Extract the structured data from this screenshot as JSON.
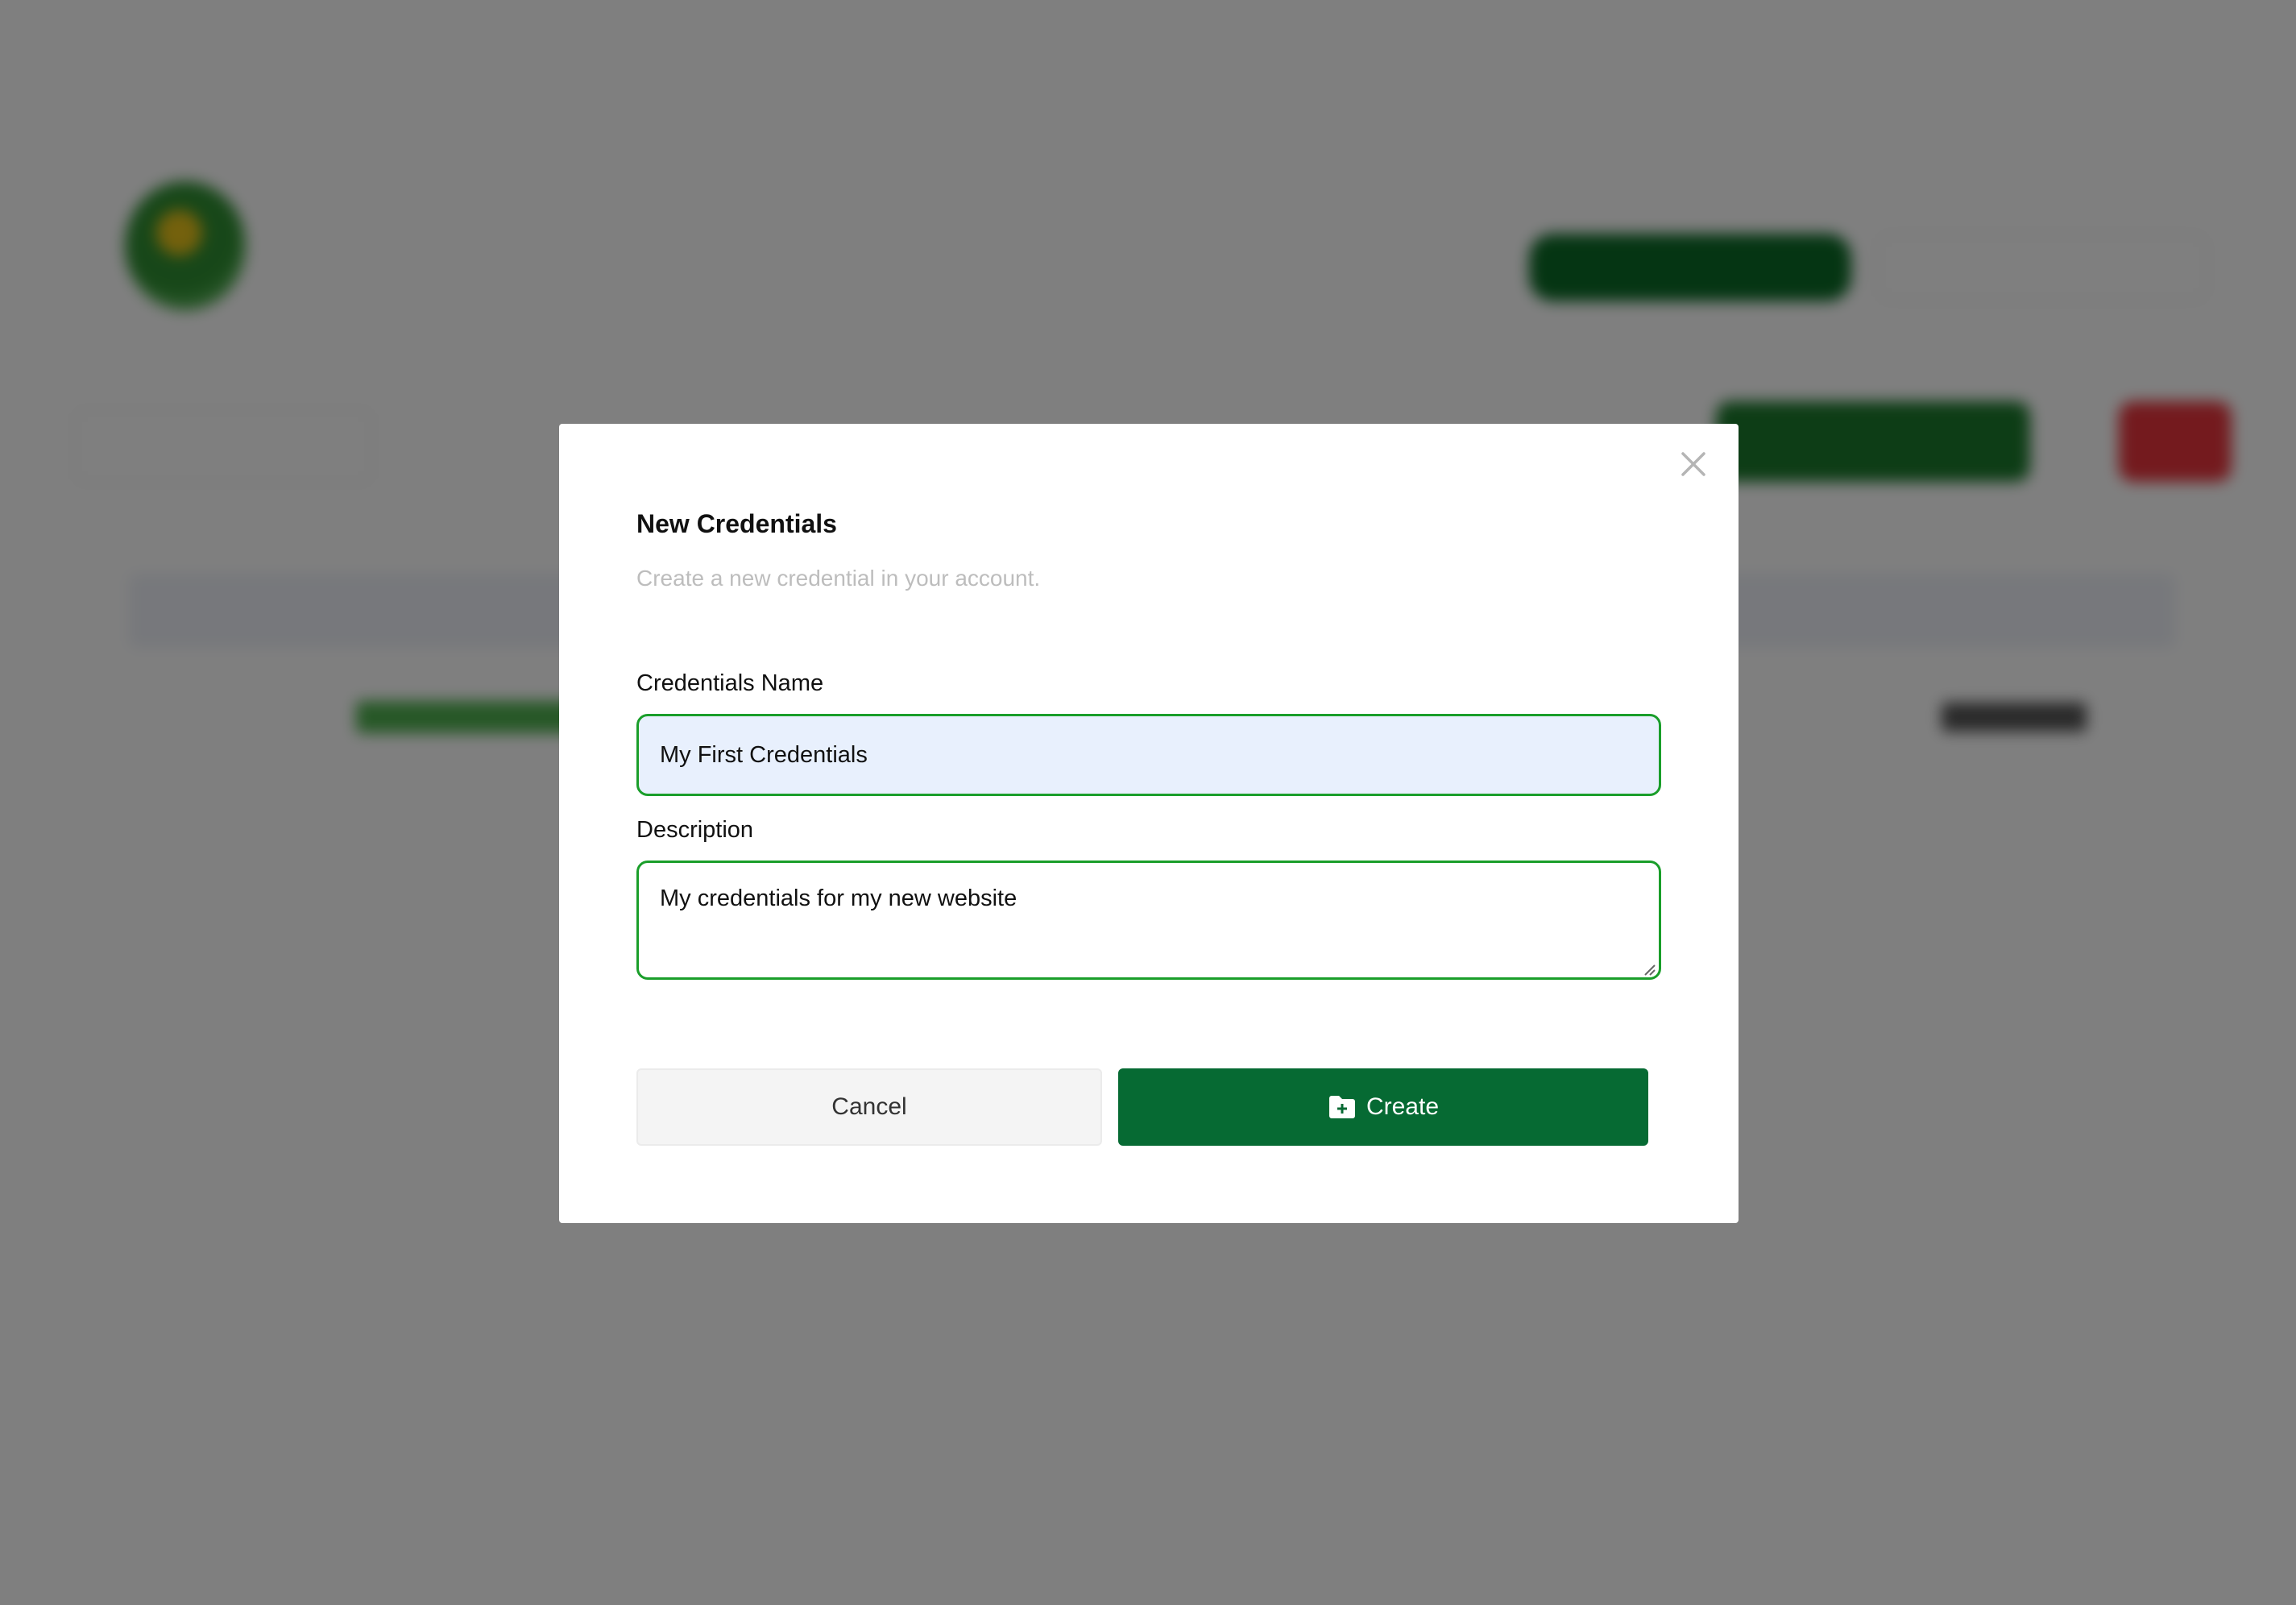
{
  "modal": {
    "title": "New Credentials",
    "subtitle": "Create a new credential in your account.",
    "name_label": "Credentials Name",
    "name_value": "My First Credentials",
    "description_label": "Description",
    "description_value": "My credentials for my new website",
    "cancel_label": "Cancel",
    "create_label": "Create",
    "close_icon": "close-icon",
    "create_icon": "folder-plus-icon"
  },
  "colors": {
    "accent": "#066a33",
    "focus_border": "#1a9e2a",
    "danger": "#e8353d"
  }
}
